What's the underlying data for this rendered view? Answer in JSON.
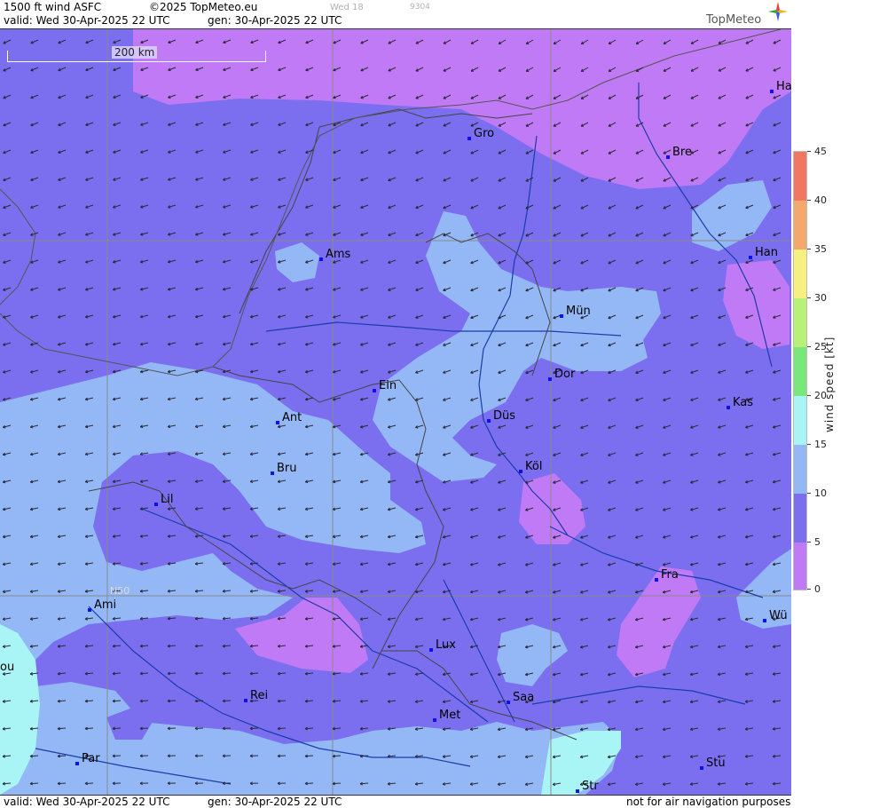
{
  "header": {
    "product": "1500 ft wind ASFC",
    "copyright": "©2025 TopMeteo.eu",
    "faint_day": "Wed 18",
    "faint_code": "9304",
    "valid": "valid:  Wed  30-Apr-2025  22 UTC",
    "generated": "gen: 30-Apr-2025 22 UTC",
    "logo": "TopMeteo"
  },
  "map": {
    "scale_label": "200 km",
    "grid_label": "N50",
    "cities": [
      {
        "name": "Gro"
      },
      {
        "name": "Bre"
      },
      {
        "name": "Ha"
      },
      {
        "name": "Ams"
      },
      {
        "name": "Han"
      },
      {
        "name": "Mün"
      },
      {
        "name": "Dor"
      },
      {
        "name": "Ein"
      },
      {
        "name": "Kas"
      },
      {
        "name": "Ant"
      },
      {
        "name": "Düs"
      },
      {
        "name": "Bru"
      },
      {
        "name": "Köl"
      },
      {
        "name": "Lil"
      },
      {
        "name": "Fra"
      },
      {
        "name": "Ami"
      },
      {
        "name": "Wü"
      },
      {
        "name": "ou"
      },
      {
        "name": "Lux"
      },
      {
        "name": "Rei"
      },
      {
        "name": "Saa"
      },
      {
        "name": "Met"
      },
      {
        "name": "Par"
      },
      {
        "name": "Stu"
      },
      {
        "name": "Str"
      }
    ],
    "wind_direction": "from east / east-southeast",
    "colors": {
      "calm": "#c17af5",
      "light": "#7b6ff0",
      "moderate": "#93b8f5",
      "strong": "#a9f5f5",
      "borders": "#555555",
      "rivers": "#1a3da8"
    }
  },
  "footer": {
    "valid": "valid:  Wed  30-Apr-2025  22 UTC",
    "generated": "gen: 30-Apr-2025 22 UTC",
    "disclaimer": "not for air navigation purposes"
  },
  "legend": {
    "title": "wind  speed  [kt]",
    "unit": "kt",
    "ticks": [
      "45",
      "40",
      "35",
      "30",
      "25",
      "20",
      "15",
      "10",
      "5",
      "0"
    ],
    "colors": [
      "#f07860",
      "#f4a86c",
      "#f6f080",
      "#b8f078",
      "#78e878",
      "#a9f5f5",
      "#93b8f5",
      "#7b6ff0",
      "#c17af5"
    ]
  }
}
